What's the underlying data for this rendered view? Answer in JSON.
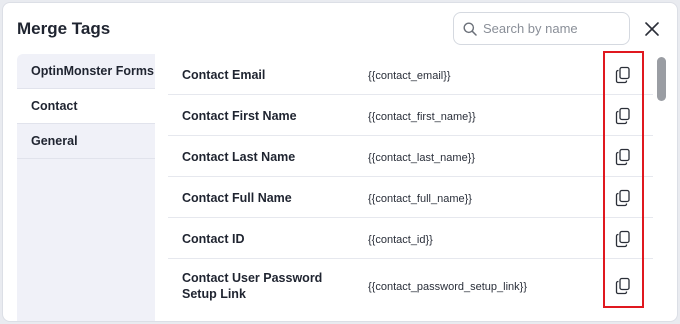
{
  "dialog": {
    "title": "Merge Tags",
    "search_placeholder": "Search by name"
  },
  "sidebar": {
    "items": [
      {
        "label": "OptinMonster Forms",
        "active": false
      },
      {
        "label": "Contact",
        "active": true
      },
      {
        "label": "General",
        "active": false
      }
    ]
  },
  "tags": [
    {
      "name": "Contact Email",
      "code": "{{contact_email}}"
    },
    {
      "name": "Contact First Name",
      "code": "{{contact_first_name}}"
    },
    {
      "name": "Contact Last Name",
      "code": "{{contact_last_name}}"
    },
    {
      "name": "Contact Full Name",
      "code": "{{contact_full_name}}"
    },
    {
      "name": "Contact ID",
      "code": "{{contact_id}}"
    },
    {
      "name": "Contact User Password Setup Link",
      "code": "{{contact_password_setup_link}}"
    }
  ],
  "icons": {
    "search": "search-icon",
    "close": "close-icon",
    "copy": "copy-icon"
  },
  "colors": {
    "highlight": "#e0181f",
    "sidebar_bg": "#f0f1f8",
    "text": "#1f2430"
  }
}
